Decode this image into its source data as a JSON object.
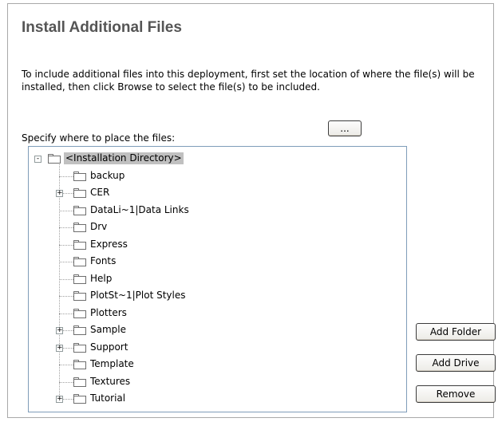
{
  "header": {
    "title": "Install Additional Files"
  },
  "description": "To include additional files into this deployment, first set the location of where the file(s) will be installed, then click Browse to select the file(s) to be included.",
  "location": {
    "label": "Specify where to place the files:",
    "browse_label": "..."
  },
  "tree": {
    "root": {
      "label": "<Installation Directory>",
      "expanded": true
    },
    "items": [
      {
        "label": "backup",
        "expandable": false
      },
      {
        "label": "CER",
        "expandable": true
      },
      {
        "label": "DataLi~1|Data Links",
        "expandable": false
      },
      {
        "label": "Drv",
        "expandable": false
      },
      {
        "label": "Express",
        "expandable": false
      },
      {
        "label": "Fonts",
        "expandable": false
      },
      {
        "label": "Help",
        "expandable": false
      },
      {
        "label": "PlotSt~1|Plot Styles",
        "expandable": false
      },
      {
        "label": "Plotters",
        "expandable": false
      },
      {
        "label": "Sample",
        "expandable": true
      },
      {
        "label": "Support",
        "expandable": true
      },
      {
        "label": "Template",
        "expandable": false
      },
      {
        "label": "Textures",
        "expandable": false
      },
      {
        "label": "Tutorial",
        "expandable": true
      }
    ]
  },
  "buttons": {
    "add_folder": "Add Folder",
    "add_drive": "Add Drive",
    "remove": "Remove"
  }
}
